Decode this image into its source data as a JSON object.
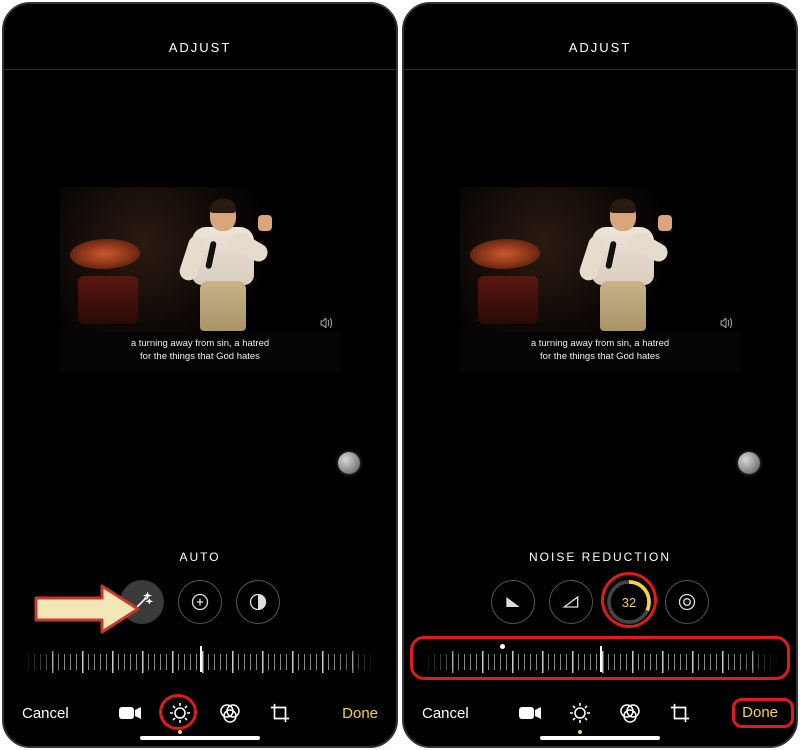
{
  "left": {
    "header": "ADJUST",
    "caption_line1": "a turning away from sin, a hatred",
    "caption_line2": "for the things that God hates",
    "tool_label": "AUTO",
    "cancel": "Cancel",
    "done": "Done"
  },
  "right": {
    "header": "ADJUST",
    "caption_line1": "a turning away from sin, a hatred",
    "caption_line2": "for the things that God hates",
    "tool_label": "NOISE REDUCTION",
    "value": "32",
    "cancel": "Cancel",
    "done": "Done"
  },
  "colors": {
    "accent": "#f7d33d",
    "annotation": "#e01b1b",
    "arrow_fill": "#f3e7b7",
    "arrow_stroke": "#c53a2e"
  }
}
